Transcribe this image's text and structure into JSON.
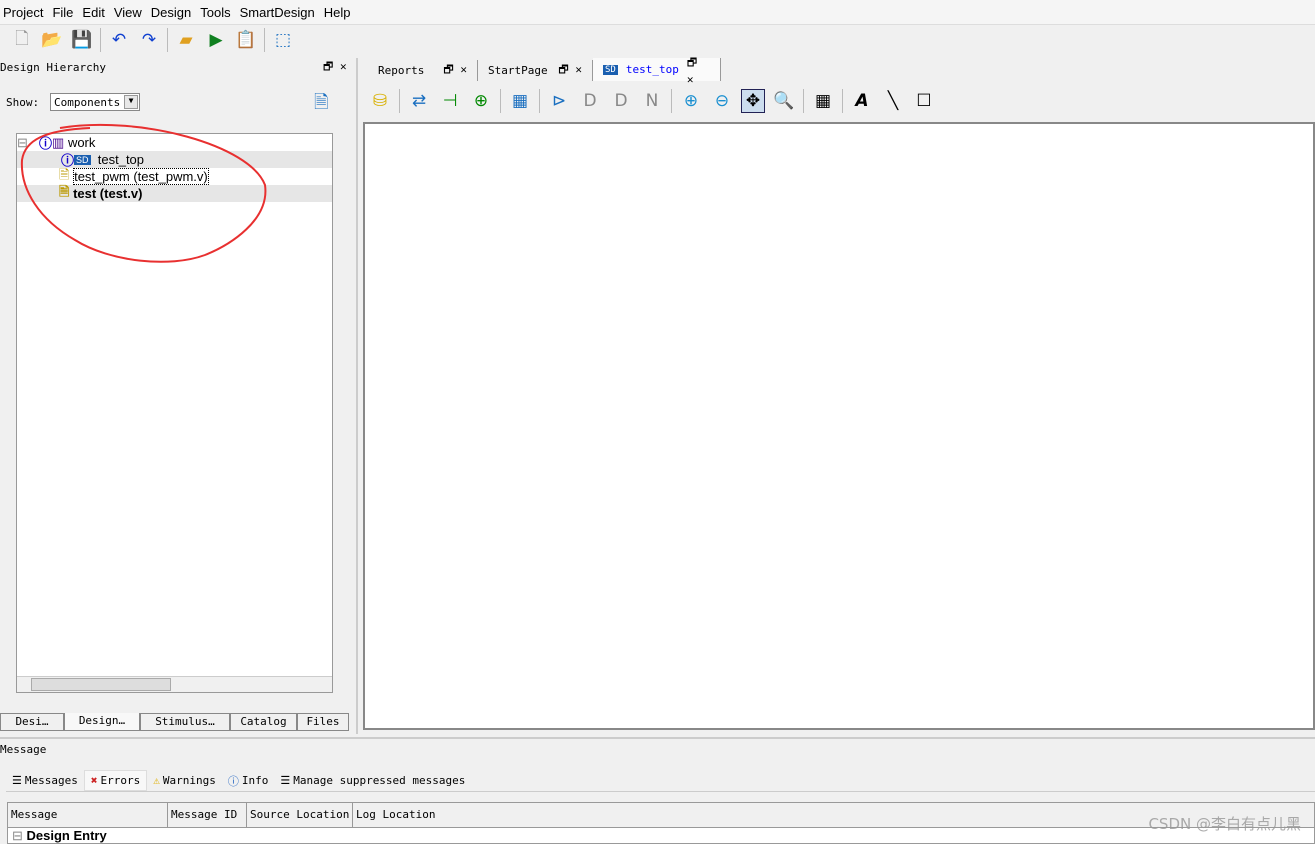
{
  "menu": [
    "Project",
    "File",
    "Edit",
    "View",
    "Design",
    "Tools",
    "SmartDesign",
    "Help"
  ],
  "toolbar": [
    "new-file-icon",
    "open-folder-icon",
    "save-icon",
    "undo-icon",
    "redo-icon",
    "package-icon",
    "run-icon",
    "report-icon",
    "window-icon"
  ],
  "hierarchy": {
    "title": "Design Hierarchy",
    "show_label": "Show:",
    "show_value": "Components",
    "tree": [
      {
        "label": "work",
        "level": 0
      },
      {
        "label": "test_top",
        "level": 1
      },
      {
        "label": "test_pwm (test_pwm.v)",
        "level": 1
      },
      {
        "label": "test (test.v)",
        "level": 1,
        "bold": true
      }
    ],
    "tabs": [
      "Desi…",
      "Design…",
      "Stimulus…",
      "Catalog",
      "Files"
    ]
  },
  "editor": {
    "tabs": [
      "Reports",
      "StartPage",
      "test_top"
    ],
    "active_tab": "test_top",
    "active_color": "#0000ff"
  },
  "message": {
    "title": "Message",
    "tabs": [
      "Messages",
      "Errors",
      "Warnings",
      "Info",
      "Manage suppressed messages"
    ],
    "columns": [
      "Message",
      "Message ID",
      "Source Location",
      "Log Location"
    ],
    "rows": [
      "Design Entry"
    ]
  },
  "watermark": "CSDN @李白有点儿黑",
  "annotation_color": "#e83030"
}
